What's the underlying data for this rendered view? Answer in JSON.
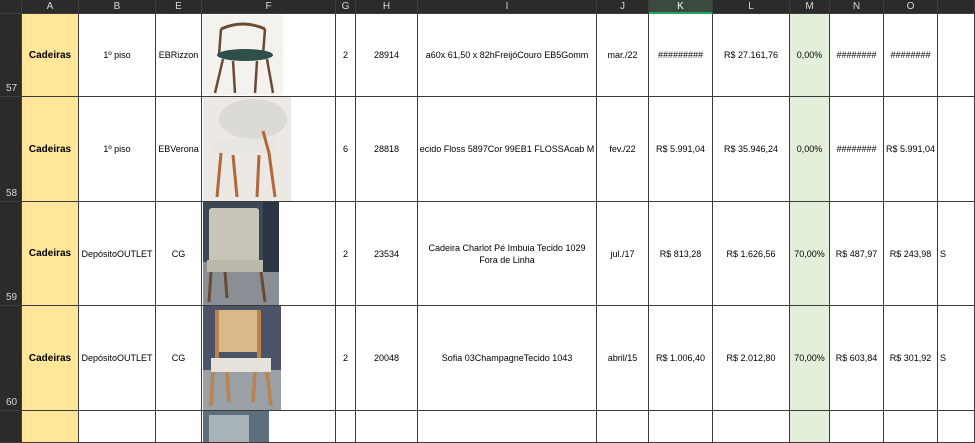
{
  "columns": [
    "A",
    "B",
    "E",
    "F",
    "G",
    "H",
    "I",
    "J",
    "K",
    "L",
    "M",
    "N",
    "O",
    ""
  ],
  "selected_column": "K",
  "rows": [
    {
      "num": "57",
      "A": "Cadeiras",
      "B": "1º piso",
      "E": "EBRizzon",
      "G": "2",
      "H": "28914",
      "I": "a60x 61,50 x 82hFreijóCouro EB5Gomm",
      "J": "mar./22",
      "K": "#########",
      "L": "R$ 27.161,76",
      "M": "0,00%",
      "N": "########",
      "O": "########",
      "P": ""
    },
    {
      "num": "58",
      "A": "Cadeiras",
      "B": "1º piso",
      "E": "EBVerona",
      "G": "6",
      "H": "28818",
      "I": "ecido Floss 5897Cor 99EB1 FLOSSAcab M",
      "J": "fev./22",
      "K": "R$ 5.991,04",
      "L": "R$ 35.946,24",
      "M": "0,00%",
      "N": "########",
      "O": "R$ 5.991,04",
      "P": ""
    },
    {
      "num": "59",
      "A": "Cadeiras",
      "B": "DepósitoOUTLET",
      "E": "CG",
      "G": "2",
      "H": "23534",
      "I": "Cadeira Charlot Pé Imbuia Tecido 1029 Fora de Linha",
      "J": "jul./17",
      "K": "R$ 813,28",
      "L": "R$ 1.626,56",
      "M": "70,00%",
      "N": "R$ 487,97",
      "O": "R$ 243,98",
      "P": "S"
    },
    {
      "num": "60",
      "A": "Cadeiras",
      "B": "DepósitoOUTLET",
      "E": "CG",
      "G": "2",
      "H": "20048",
      "I": "Sofia 03ChampagneTecido 1043",
      "J": "abril/15",
      "K": "R$ 1.006,40",
      "L": "R$ 2.012,80",
      "M": "70,00%",
      "N": "R$ 603,84",
      "O": "R$ 301,92",
      "P": "S"
    },
    {
      "num": "",
      "A": "",
      "B": "",
      "E": "",
      "G": "",
      "H": "",
      "I": "",
      "J": "",
      "K": "",
      "L": "",
      "M": "",
      "N": "",
      "O": "",
      "P": ""
    }
  ]
}
